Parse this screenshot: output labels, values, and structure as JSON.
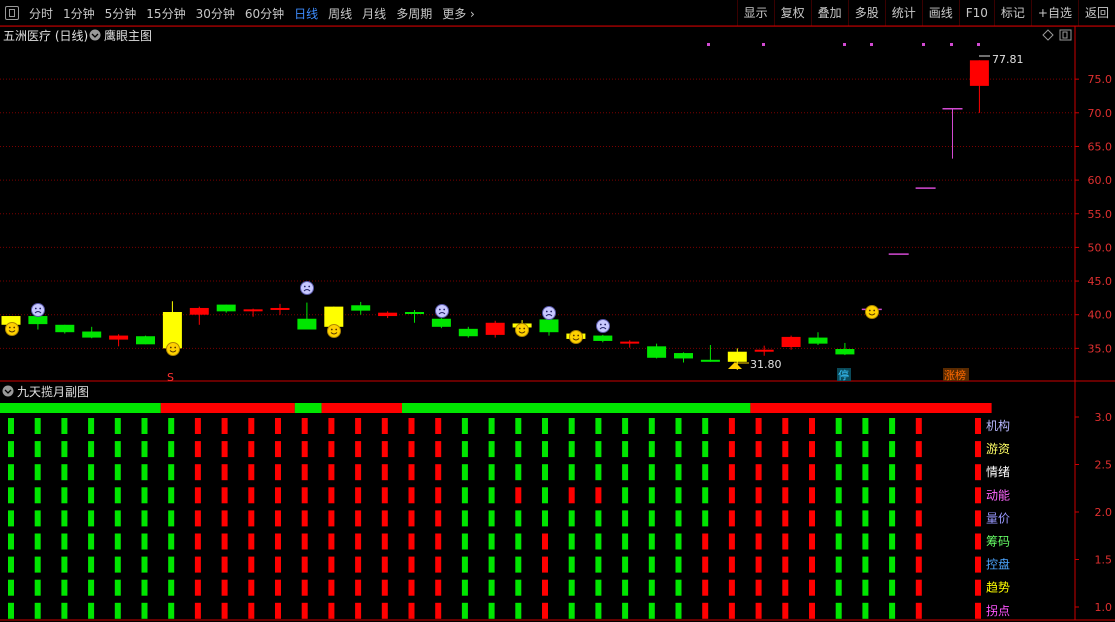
{
  "toolbar": {
    "timeframes": [
      "分时",
      "1分钟",
      "5分钟",
      "15分钟",
      "30分钟",
      "60分钟",
      "日线",
      "周线",
      "月线",
      "多周期",
      "更多"
    ],
    "active": "日线",
    "right_buttons": [
      "显示",
      "复权",
      "叠加",
      "多股",
      "统计",
      "画线",
      "F10",
      "标记",
      "+自选",
      "返回"
    ],
    "more_glyph": "›"
  },
  "main_chart": {
    "stock_title": "五洲医疗 (日线)",
    "indicator_name": "鹰眼主图",
    "y_ticks": [
      "75.0",
      "70.0",
      "65.0",
      "60.0",
      "55.0",
      "50.0",
      "45.0",
      "40.0",
      "35.0"
    ],
    "high_label": "77.81",
    "low_label": "31.80",
    "tags": [
      {
        "text": "停",
        "color": "#39c6ff"
      },
      {
        "text": "涨榜",
        "color": "#ff6a00"
      }
    ],
    "s_marker": "S",
    "colors": {
      "up": "#ff0000",
      "down": "#00e600",
      "yellow": "#ffff00",
      "grid": "#7a0000",
      "axis": "#cc0000",
      "magenta": "#d24ad2"
    }
  },
  "sub_chart": {
    "title": "九天揽月副图",
    "y_ticks": [
      "3.0",
      "2.5",
      "2.0",
      "1.5",
      "1.0"
    ],
    "rows": [
      {
        "label": "机构",
        "color": "#b8b8ff"
      },
      {
        "label": "游资",
        "color": "#ffff66"
      },
      {
        "label": "情绪",
        "color": "#ffffff"
      },
      {
        "label": "动能",
        "color": "#ff66ff"
      },
      {
        "label": "量价",
        "color": "#9999ff"
      },
      {
        "label": "筹码",
        "color": "#66ff66"
      },
      {
        "label": "控盘",
        "color": "#4da6ff"
      },
      {
        "label": "趋势",
        "color": "#ffff00"
      },
      {
        "label": "拐点",
        "color": "#ff55ff"
      }
    ],
    "top_bar": [
      {
        "start": 0,
        "end": 6,
        "color": "g"
      },
      {
        "start": 6,
        "end": 11,
        "color": "r"
      },
      {
        "start": 11,
        "end": 12,
        "color": "g"
      },
      {
        "start": 12,
        "end": 15,
        "color": "r"
      },
      {
        "start": 15,
        "end": 28,
        "color": "g"
      },
      {
        "start": 28,
        "end": 37,
        "color": "r"
      }
    ],
    "grid": [
      "gggggggrrrrrrrrrrggggggggggrrrrgggr",
      "gggggggrrrrrrrrrrggggggggggrrrrgggr",
      "gggggggrrrrrrrrrrggggggggggrrrrgggr",
      "gggggggrrrrrrrrrrggrgrrggggrrrrgggr",
      "gggggggrrrrrrrrrrggggggggggrrrrgggr",
      "gggggggrrrrrrrrrrgggrgggggrrrrrgggr",
      "gggggggrrrrrrrrrrgggrgggggrrrrrgggr",
      "gggggggrrrrrrrrrrgggrgggggrrrrrgggr",
      "gggggggrrrrrrrrrrgggrgggggrrrrrgggr"
    ]
  },
  "chart_data": {
    "type": "candlestick",
    "title": "五洲医疗 (日线)",
    "ylim": [
      30,
      79
    ],
    "candles": [
      {
        "o": 38.5,
        "c": 39.8,
        "h": 39.8,
        "l": 38.5,
        "t": "y"
      },
      {
        "o": 39.8,
        "c": 38.6,
        "h": 40.1,
        "l": 37.8,
        "t": "g"
      },
      {
        "o": 38.5,
        "c": 37.4,
        "h": 38.5,
        "l": 37.2,
        "t": "g"
      },
      {
        "o": 37.5,
        "c": 36.6,
        "h": 38.2,
        "l": 36.5,
        "t": "g"
      },
      {
        "o": 36.3,
        "c": 36.9,
        "h": 37.1,
        "l": 35.3,
        "t": "r"
      },
      {
        "o": 36.8,
        "c": 35.6,
        "h": 36.9,
        "l": 35.6,
        "t": "g"
      },
      {
        "o": 40.4,
        "c": 35.0,
        "h": 42.0,
        "l": 35.0,
        "t": "y"
      },
      {
        "o": 40.0,
        "c": 41.0,
        "h": 41.2,
        "l": 38.5,
        "t": "r"
      },
      {
        "o": 41.5,
        "c": 40.5,
        "h": 41.5,
        "l": 40.3,
        "t": "g"
      },
      {
        "o": 40.6,
        "c": 40.8,
        "h": 40.9,
        "l": 39.7,
        "t": "r"
      },
      {
        "o": 40.9,
        "c": 41.0,
        "h": 41.6,
        "l": 40.0,
        "t": "r"
      },
      {
        "o": 39.4,
        "c": 37.8,
        "h": 41.8,
        "l": 37.8,
        "t": "g"
      },
      {
        "o": 41.2,
        "c": 38.2,
        "h": 41.2,
        "l": 38.2,
        "t": "y"
      },
      {
        "o": 41.4,
        "c": 40.6,
        "h": 41.9,
        "l": 40.0,
        "t": "g"
      },
      {
        "o": 40.3,
        "c": 39.8,
        "h": 40.5,
        "l": 39.5,
        "t": "r"
      },
      {
        "o": 40.4,
        "c": 40.2,
        "h": 40.7,
        "l": 38.8,
        "t": "g"
      },
      {
        "o": 39.4,
        "c": 38.2,
        "h": 39.9,
        "l": 38.0,
        "t": "g"
      },
      {
        "o": 37.9,
        "c": 36.8,
        "h": 38.2,
        "l": 36.6,
        "t": "g"
      },
      {
        "o": 37.0,
        "c": 38.8,
        "h": 39.1,
        "l": 36.6,
        "t": "r"
      },
      {
        "o": 38.7,
        "c": 38.1,
        "h": 39.2,
        "l": 37.8,
        "t": "y"
      },
      {
        "o": 39.3,
        "c": 37.4,
        "h": 39.4,
        "l": 36.9,
        "t": "g"
      },
      {
        "o": 37.2,
        "c": 36.4,
        "h": 37.4,
        "l": 36.2,
        "t": "y"
      },
      {
        "o": 36.9,
        "c": 36.1,
        "h": 37.0,
        "l": 35.9,
        "t": "g"
      },
      {
        "o": 35.8,
        "c": 36.0,
        "h": 36.2,
        "l": 35.1,
        "t": "r"
      },
      {
        "o": 35.3,
        "c": 33.6,
        "h": 35.7,
        "l": 33.5,
        "t": "g"
      },
      {
        "o": 34.3,
        "c": 33.5,
        "h": 34.4,
        "l": 32.9,
        "t": "g"
      },
      {
        "o": 33.3,
        "c": 33.1,
        "h": 35.5,
        "l": 33.0,
        "t": "g"
      },
      {
        "o": 33.0,
        "c": 34.5,
        "h": 35.0,
        "l": 31.8,
        "t": "y"
      },
      {
        "o": 34.5,
        "c": 34.8,
        "h": 35.4,
        "l": 33.9,
        "t": "r"
      },
      {
        "o": 35.2,
        "c": 36.7,
        "h": 36.9,
        "l": 34.8,
        "t": "r"
      },
      {
        "o": 36.6,
        "c": 35.7,
        "h": 37.4,
        "l": 35.5,
        "t": "g"
      },
      {
        "o": 34.9,
        "c": 34.1,
        "h": 35.8,
        "l": 34.0,
        "t": "g"
      },
      {
        "o": 40.8,
        "c": 40.8,
        "h": 40.8,
        "l": 40.8,
        "t": "m"
      },
      {
        "o": 49.0,
        "c": 49.0,
        "h": 49.0,
        "l": 49.0,
        "t": "m"
      },
      {
        "o": 58.8,
        "c": 58.8,
        "h": 58.8,
        "l": 58.8,
        "t": "m"
      },
      {
        "o": 70.6,
        "c": 70.6,
        "h": 70.6,
        "l": 63.2,
        "t": "m"
      },
      {
        "o": 74.0,
        "c": 77.8,
        "h": 77.8,
        "l": 70.0,
        "t": "r"
      }
    ]
  }
}
